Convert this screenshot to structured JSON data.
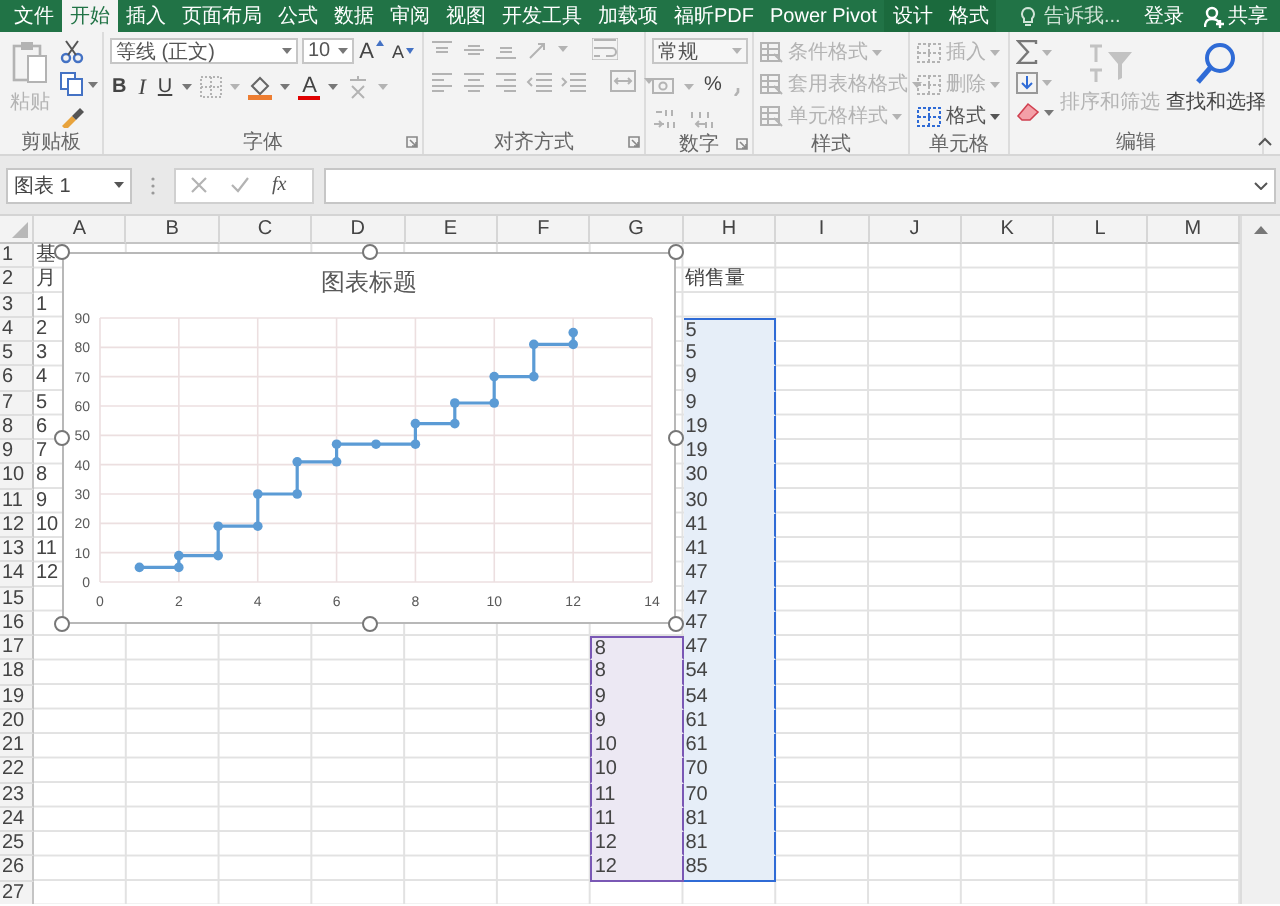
{
  "tabs": [
    {
      "label": "文件",
      "selected": false,
      "kind": "file"
    },
    {
      "label": "开始",
      "selected": true,
      "kind": "normal"
    },
    {
      "label": "插入",
      "selected": false,
      "kind": "normal"
    },
    {
      "label": "页面布局",
      "selected": false,
      "kind": "normal"
    },
    {
      "label": "公式",
      "selected": false,
      "kind": "normal"
    },
    {
      "label": "数据",
      "selected": false,
      "kind": "normal"
    },
    {
      "label": "审阅",
      "selected": false,
      "kind": "normal"
    },
    {
      "label": "视图",
      "selected": false,
      "kind": "normal"
    },
    {
      "label": "开发工具",
      "selected": false,
      "kind": "normal"
    },
    {
      "label": "加载项",
      "selected": false,
      "kind": "normal"
    },
    {
      "label": "福昕PDF",
      "selected": false,
      "kind": "normal"
    },
    {
      "label": "Power Pivot",
      "selected": false,
      "kind": "normal"
    },
    {
      "label": "设计",
      "selected": false,
      "kind": "context"
    },
    {
      "label": "格式",
      "selected": false,
      "kind": "context"
    }
  ],
  "tell_me": {
    "placeholder": "告诉我..."
  },
  "account": {
    "sign_in": "登录",
    "share": "共享"
  },
  "ribbon": {
    "groups": [
      {
        "kind": "clipboard",
        "label": "剪贴板",
        "paste": {
          "label": "粘贴",
          "disabled": true
        }
      },
      {
        "kind": "font",
        "label": "字体",
        "font_name": "等线 (正文)",
        "font_size": "10",
        "grow": "A",
        "shrink": "A",
        "bold": "B",
        "italic": "I",
        "underline": "U",
        "font_color": "A"
      },
      {
        "kind": "alignment",
        "label": "对齐方式",
        "disabled": true
      },
      {
        "kind": "number",
        "label": "数字",
        "format": "常规",
        "percent": "%",
        "disabled": true
      },
      {
        "kind": "styles",
        "label": "样式",
        "items": [
          {
            "label": "条件格式",
            "disabled": true
          },
          {
            "label": "套用表格格式",
            "disabled": true
          },
          {
            "label": "单元格样式",
            "disabled": true
          }
        ]
      },
      {
        "kind": "cells",
        "label": "单元格",
        "items": [
          {
            "label": "插入",
            "disabled": true
          },
          {
            "label": "删除",
            "disabled": true
          },
          {
            "label": "格式",
            "disabled": false
          }
        ]
      },
      {
        "kind": "editing",
        "label": "编辑",
        "items": [
          {
            "label": "排序和筛选",
            "disabled": true
          },
          {
            "label": "查找和选择",
            "disabled": false
          }
        ]
      }
    ]
  },
  "formula_bar": {
    "name_box": "图表 1",
    "function_button": "fx"
  },
  "sheet": {
    "columns": [
      "A",
      "B",
      "C",
      "D",
      "E",
      "F",
      "G",
      "H",
      "I",
      "J",
      "K",
      "L",
      "M"
    ],
    "rows": [
      {
        "number": "1",
        "a": {
          "text": "基"
        }
      },
      {
        "number": "2",
        "a": {
          "text": "月"
        },
        "h": {
          "text": "销售量"
        }
      },
      {
        "number": "3",
        "a": {
          "text": "1"
        }
      },
      {
        "number": "4",
        "a": {
          "text": "2"
        },
        "h": {
          "text": "5",
          "kind": "y-range"
        }
      },
      {
        "number": "5",
        "a": {
          "text": "3"
        },
        "h": {
          "text": "5",
          "kind": "y-range"
        }
      },
      {
        "number": "6",
        "a": {
          "text": "4"
        },
        "h": {
          "text": "9",
          "kind": "y-range"
        }
      },
      {
        "number": "7",
        "a": {
          "text": "5"
        },
        "h": {
          "text": "9",
          "kind": "y-range"
        }
      },
      {
        "number": "8",
        "a": {
          "text": "6"
        },
        "h": {
          "text": "19",
          "kind": "y-range"
        }
      },
      {
        "number": "9",
        "a": {
          "text": "7"
        },
        "h": {
          "text": "19",
          "kind": "y-range"
        }
      },
      {
        "number": "10",
        "a": {
          "text": "8"
        },
        "h": {
          "text": "30",
          "kind": "y-range"
        }
      },
      {
        "number": "11",
        "a": {
          "text": "9"
        },
        "h": {
          "text": "30",
          "kind": "y-range"
        }
      },
      {
        "number": "12",
        "a": {
          "text": "10"
        },
        "h": {
          "text": "41",
          "kind": "y-range"
        }
      },
      {
        "number": "13",
        "a": {
          "text": "11"
        },
        "h": {
          "text": "41",
          "kind": "y-range"
        }
      },
      {
        "number": "14",
        "a": {
          "text": "12"
        },
        "h": {
          "text": "47",
          "kind": "y-range"
        }
      },
      {
        "number": "15",
        "h": {
          "text": "47",
          "kind": "y-range"
        }
      },
      {
        "number": "16",
        "h": {
          "text": "47",
          "kind": "y-range"
        }
      },
      {
        "number": "17",
        "g": {
          "text": "8",
          "kind": "x-range"
        },
        "h": {
          "text": "47",
          "kind": "y-range"
        }
      },
      {
        "number": "18",
        "g": {
          "text": "8",
          "kind": "x-range"
        },
        "h": {
          "text": "54",
          "kind": "y-range"
        }
      },
      {
        "number": "19",
        "g": {
          "text": "9",
          "kind": "x-range"
        },
        "h": {
          "text": "54",
          "kind": "y-range"
        }
      },
      {
        "number": "20",
        "g": {
          "text": "9",
          "kind": "x-range"
        },
        "h": {
          "text": "61",
          "kind": "y-range"
        }
      },
      {
        "number": "21",
        "g": {
          "text": "10",
          "kind": "x-range"
        },
        "h": {
          "text": "61",
          "kind": "y-range"
        }
      },
      {
        "number": "22",
        "g": {
          "text": "10",
          "kind": "x-range"
        },
        "h": {
          "text": "70",
          "kind": "y-range"
        }
      },
      {
        "number": "23",
        "g": {
          "text": "11",
          "kind": "x-range"
        },
        "h": {
          "text": "70",
          "kind": "y-range"
        }
      },
      {
        "number": "24",
        "g": {
          "text": "11",
          "kind": "x-range"
        },
        "h": {
          "text": "81",
          "kind": "y-range"
        }
      },
      {
        "number": "25",
        "g": {
          "text": "12",
          "kind": "x-range"
        },
        "h": {
          "text": "81",
          "kind": "y-range"
        }
      },
      {
        "number": "26",
        "g": {
          "text": "12",
          "kind": "x-range"
        },
        "h": {
          "text": "85",
          "kind": "y-range"
        }
      },
      {
        "number": "27"
      }
    ]
  },
  "chart": {
    "chart_data": {
      "type": "line",
      "title": "图表标题",
      "grid": true,
      "x": [
        1,
        2,
        2,
        3,
        3,
        4,
        4,
        5,
        5,
        6,
        6,
        7,
        7,
        8,
        8,
        9,
        9,
        10,
        10,
        11,
        11,
        12,
        12
      ],
      "series": [
        {
          "color": "#5b9bd5",
          "marker": "circle",
          "values": [
            5,
            5,
            9,
            9,
            19,
            19,
            30,
            30,
            41,
            41,
            47,
            47,
            47,
            47,
            54,
            54,
            61,
            61,
            70,
            70,
            81,
            81,
            85
          ]
        }
      ],
      "xlim": [
        0,
        14
      ],
      "ylim": [
        0,
        90
      ],
      "xticks": [
        0,
        2,
        4,
        6,
        8,
        10,
        12,
        14
      ],
      "yticks": [
        0,
        10,
        20,
        30,
        40,
        50,
        60,
        70,
        80,
        90
      ]
    }
  }
}
